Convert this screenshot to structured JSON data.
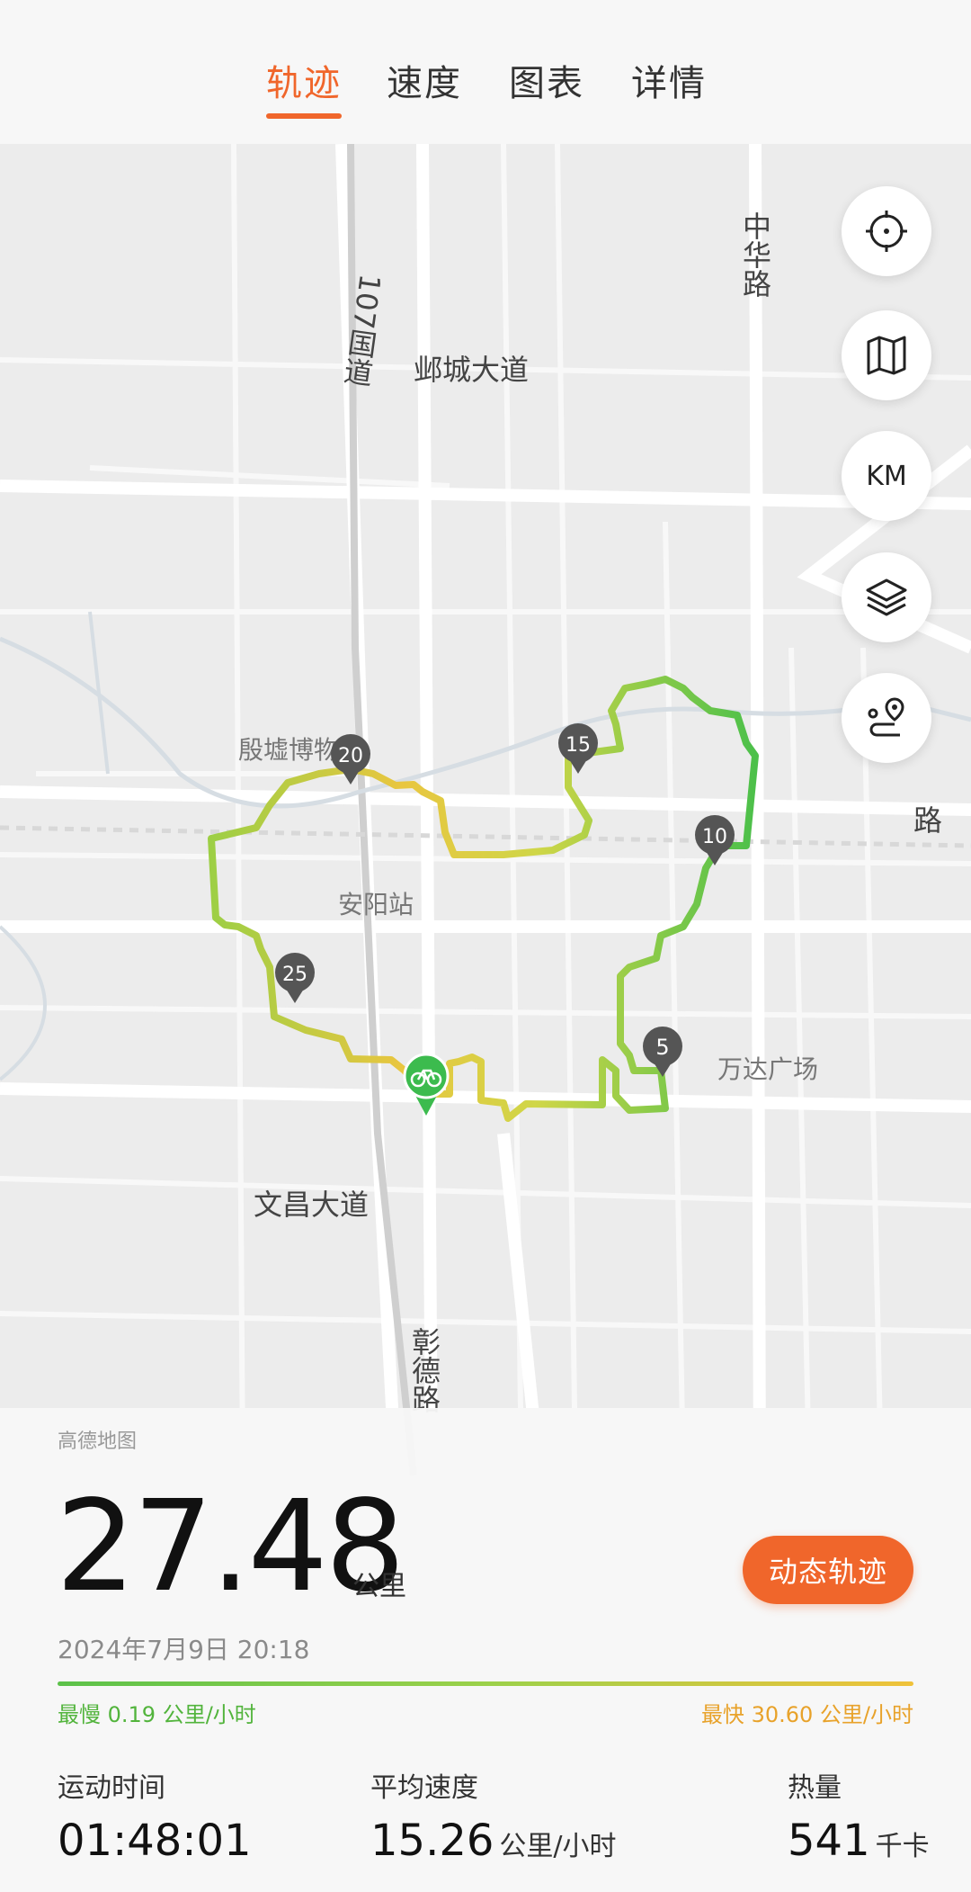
{
  "tabs": [
    {
      "label": "轨迹",
      "active": true
    },
    {
      "label": "速度",
      "active": false
    },
    {
      "label": "图表",
      "active": false
    },
    {
      "label": "详情",
      "active": false
    }
  ],
  "map": {
    "roads": {
      "r107": "107国道",
      "yecheng": "邺城大道",
      "zhonghua": "中华路",
      "wenchang": "文昌大道",
      "zhangde": "彰德路",
      "right_edge": "路"
    },
    "places": {
      "museum": "殷墟博物馆",
      "station": "安阳站",
      "wanda": "万达广场"
    },
    "km_markers": [
      "5",
      "10",
      "15",
      "20",
      "25"
    ],
    "credit": "高德地图"
  },
  "controls": {
    "locate": "locate-icon",
    "map": "map-icon",
    "km": "KM",
    "layers": "layers-icon",
    "route": "route-icon"
  },
  "summary": {
    "distance": "27.48",
    "distance_unit": "公里",
    "date": "2024年7月9日 20:18",
    "dynamic_button": "动态轨迹",
    "slowest": "最慢 0.19 公里/小时",
    "fastest": "最快 30.60 公里/小时",
    "stats": [
      {
        "label": "运动时间",
        "value": "01:48:01",
        "unit": ""
      },
      {
        "label": "平均速度",
        "value": "15.26",
        "unit": "公里/小时"
      },
      {
        "label": "热量",
        "value": "541",
        "unit": "千卡"
      }
    ]
  },
  "colors": {
    "accent": "#f0662b",
    "track_green": "#4cc04a",
    "track_yellow": "#e9c640"
  }
}
